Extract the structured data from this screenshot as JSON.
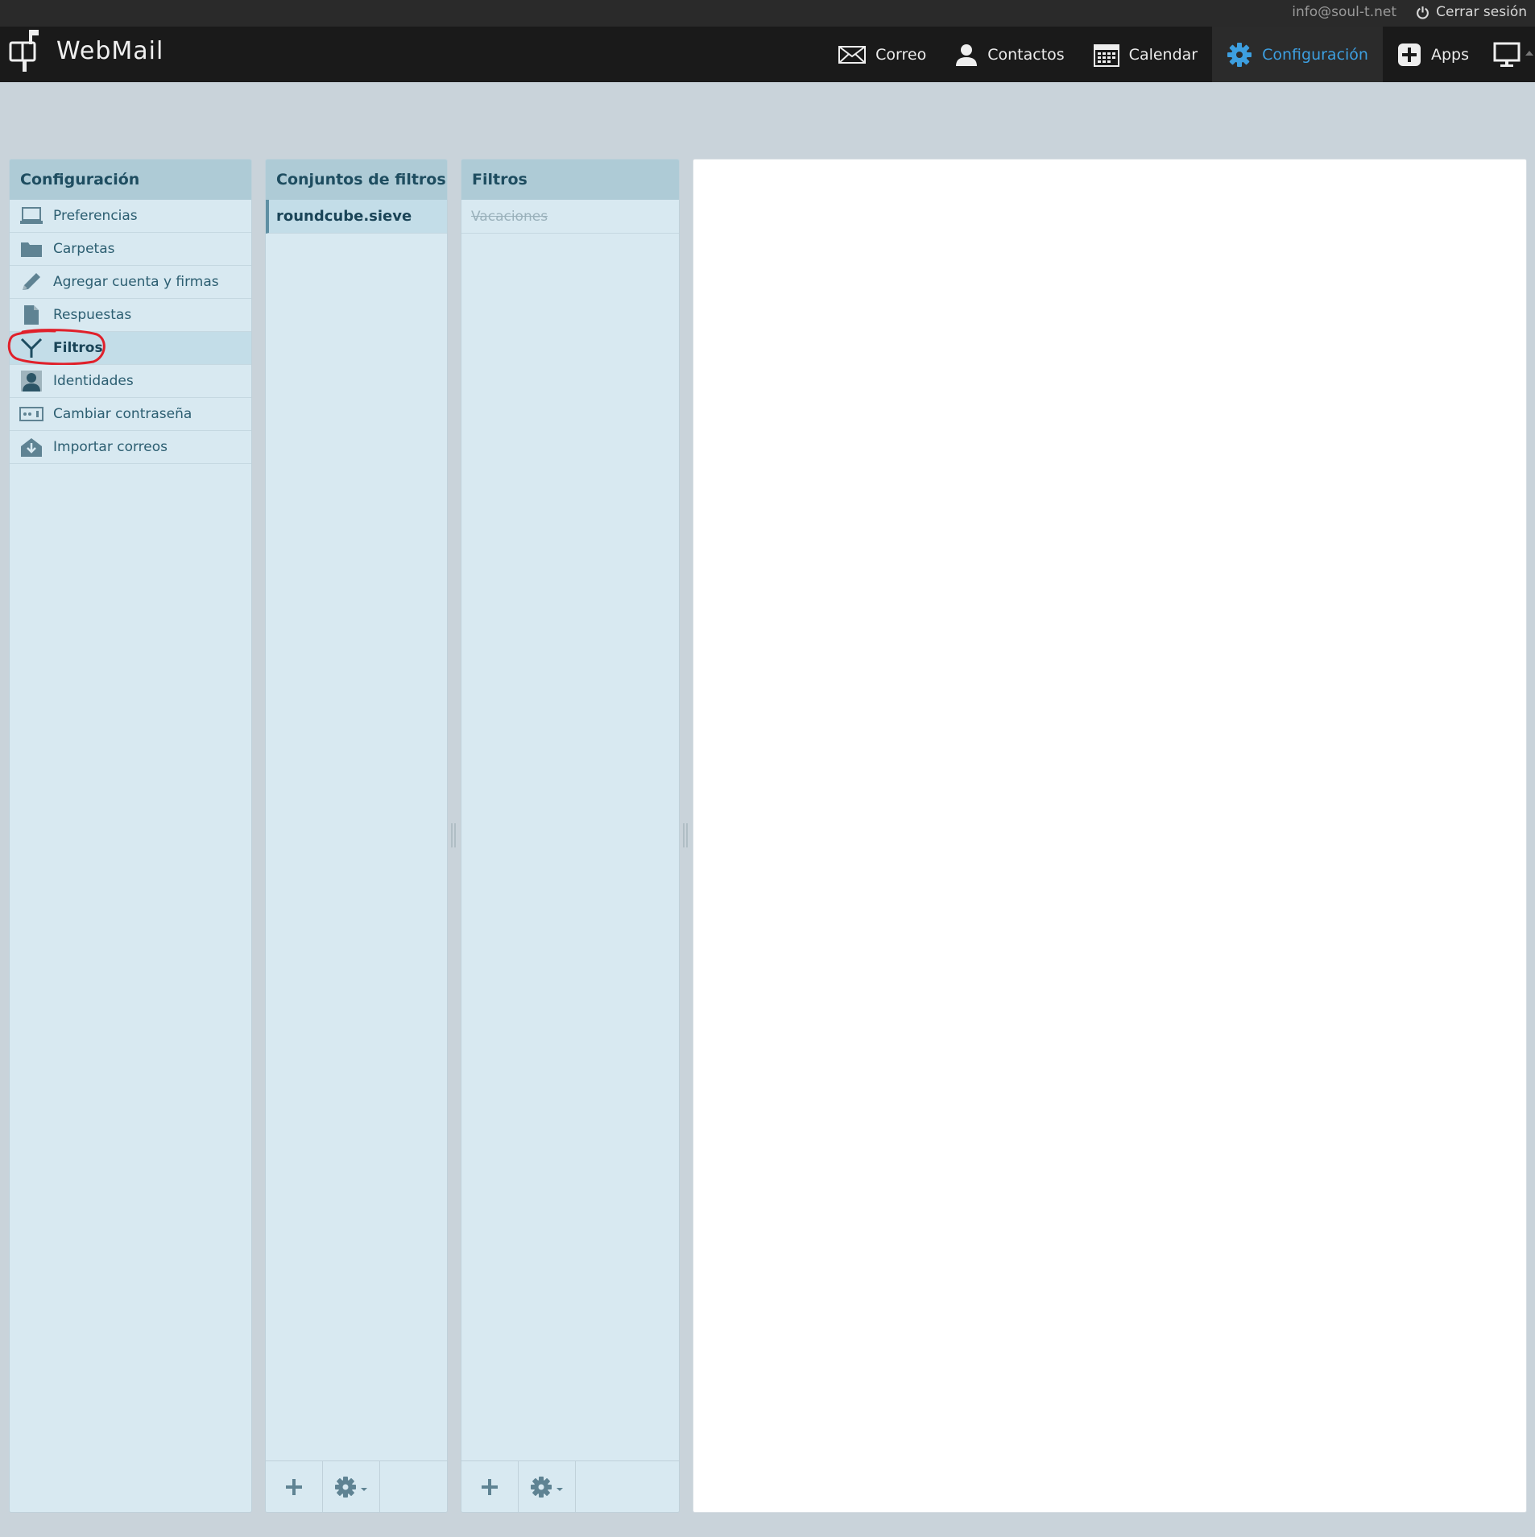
{
  "header": {
    "app_name": "WebMail",
    "user_email": "info@soul-t.net",
    "logout_label": "Cerrar sesión",
    "nav": [
      {
        "label": "Correo",
        "icon": "envelope-icon"
      },
      {
        "label": "Contactos",
        "icon": "person-icon"
      },
      {
        "label": "Calendar",
        "icon": "calendar-icon"
      },
      {
        "label": "Configuración",
        "icon": "gear-icon",
        "active": true
      },
      {
        "label": "Apps",
        "icon": "plus-icon"
      },
      {
        "label": "",
        "icon": "monitor-icon"
      }
    ]
  },
  "settings_panel": {
    "title": "Configuración",
    "items": [
      {
        "label": "Preferencias",
        "icon": "laptop-icon"
      },
      {
        "label": "Carpetas",
        "icon": "folder-icon"
      },
      {
        "label": "Agregar cuenta y firmas",
        "icon": "pencil-icon"
      },
      {
        "label": "Respuestas",
        "icon": "document-icon"
      },
      {
        "label": "Filtros",
        "icon": "filter-icon",
        "selected": true
      },
      {
        "label": "Identidades",
        "icon": "identity-icon"
      },
      {
        "label": "Cambiar contraseña",
        "icon": "password-icon"
      },
      {
        "label": "Importar correos",
        "icon": "import-icon"
      }
    ]
  },
  "filter_sets_panel": {
    "title": "Conjuntos de filtros",
    "items": [
      {
        "label": "roundcube.sieve",
        "selected": true
      }
    ]
  },
  "filters_panel": {
    "title": "Filtros",
    "items": [
      {
        "label": "Vacaciones",
        "disabled": true
      }
    ]
  },
  "colors": {
    "active_nav": "#3d9fe0",
    "annotation": "#e0202a",
    "panel_bg": "#d8e9f1",
    "panel_header": "#aecbd6"
  }
}
